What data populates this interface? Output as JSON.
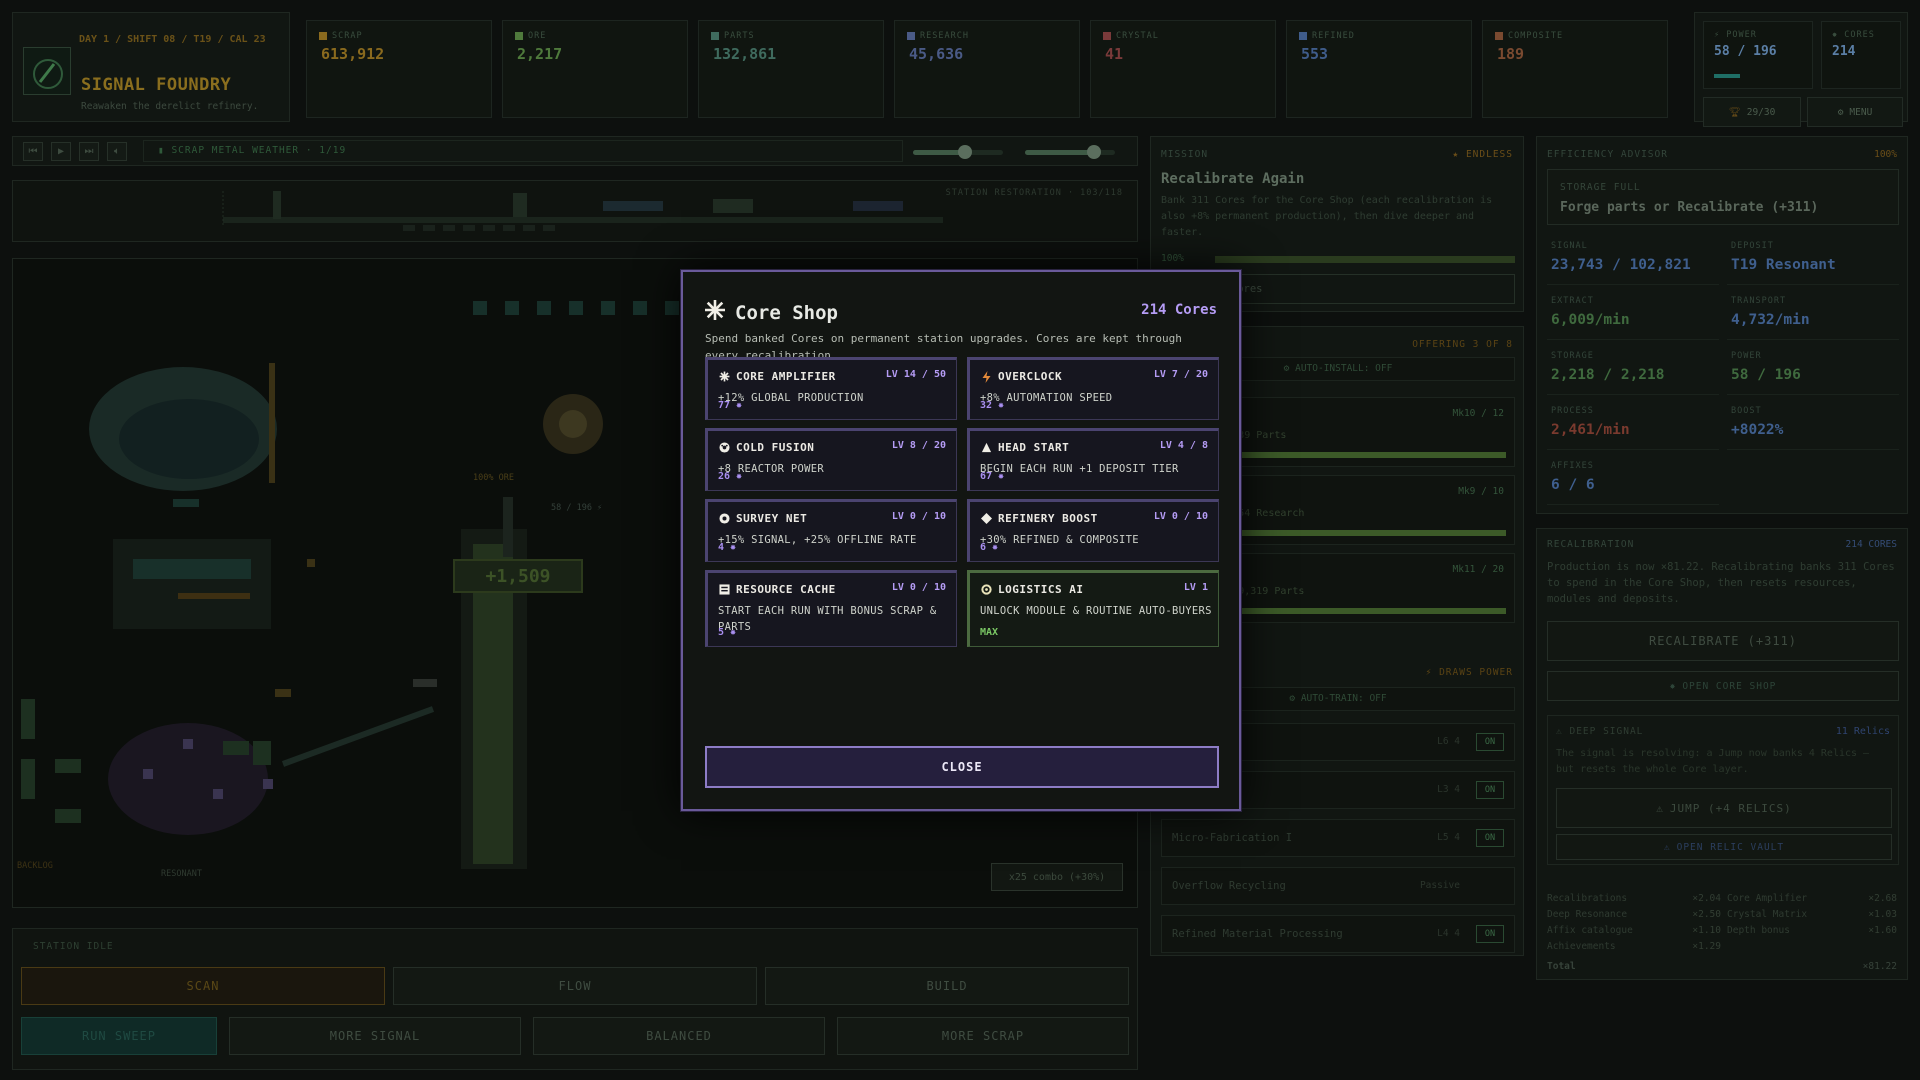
{
  "brand": {
    "meta": "DAY 1 / SHIFT 08 / T19 / CAL 23",
    "title": "SIGNAL FOUNDRY",
    "subtitle": "Reawaken the derelict refinery."
  },
  "resources": [
    {
      "label": "SCRAP",
      "value": "613,912",
      "color": "#8a6a1e"
    },
    {
      "label": "ORE",
      "value": "2,217",
      "color": "#4f7a3c"
    },
    {
      "label": "PARTS",
      "value": "132,861",
      "color": "#3f6b5e"
    },
    {
      "label": "RESEARCH",
      "value": "45,636",
      "color": "#4a5a86"
    },
    {
      "label": "CRYSTAL",
      "value": "41",
      "color": "#7a3a3a"
    },
    {
      "label": "REFINED",
      "value": "553",
      "color": "#3f5c8a"
    },
    {
      "label": "COMPOSITE",
      "value": "189",
      "color": "#7a4a30"
    }
  ],
  "power": {
    "power_label": "POWER",
    "power_value": "58 / 196",
    "cores_label": "CORES",
    "cores_value": "214",
    "slots_label": "29/30",
    "menu_label": "MENU"
  },
  "transport": {
    "weather": "SCRAP METAL WEATHER · 1/19"
  },
  "restoration": {
    "label": "STATION RESTORATION · 103/118"
  },
  "scene": {
    "ore_label": "100% ORE",
    "power_label": "58 / 196 ⚡",
    "popup": "+1,509",
    "backlog": "BACKLOG",
    "resonant": "RESONANT",
    "combo": "x25 combo (+30%)"
  },
  "controls": {
    "status": "STATION IDLE",
    "tabs": [
      "SCAN",
      "FLOW",
      "BUILD"
    ],
    "actions": [
      "RUN SWEEP",
      "MORE SIGNAL",
      "BALANCED",
      "MORE SCRAP"
    ]
  },
  "mission": {
    "header": "MISSION",
    "endless": "ENDLESS",
    "title": "Recalibrate Again",
    "desc": "Bank 311 Cores for the Core Shop (each recalibration is also +8% permanent production), then dive deeper and faster.",
    "pct": "100%",
    "prestige": "Prestige Cores"
  },
  "automation": {
    "offering": "OFFERING 3 OF 8",
    "auto_install": "AUTO-INSTALL: OFF",
    "rows": [
      {
        "name": "d",
        "mk": "Mk10 / 12",
        "cost": "63 Scrap, 639 Parts"
      },
      {
        "name": "Routine",
        "mk": "Mk9 / 10",
        "cost": "23 Parts, 854 Research"
      },
      {
        "name": "ore",
        "mk": "Mk11 / 20",
        "cost": "894 Scrap, 9,319 Parts"
      }
    ],
    "draws_power": "DRAWS POWER",
    "auto_train": "AUTO-TRAIN: OFF",
    "toggles": [
      {
        "name": "r Routine",
        "lv": "L6 4",
        "state": "ON"
      },
      {
        "name": "ng I",
        "lv": "L3 4",
        "state": "ON"
      },
      {
        "name": "Micro-Fabrication I",
        "lv": "L5 4",
        "state": "ON"
      },
      {
        "name": "Overflow Recycling",
        "lv": "Passive",
        "state": ""
      },
      {
        "name": "Refined Material Processing",
        "lv": "L4 4",
        "state": "ON"
      }
    ]
  },
  "advisor": {
    "header": "EFFICIENCY ADVISOR",
    "pct": "100%",
    "banner_title": "STORAGE FULL",
    "banner_text": "Forge parts or Recalibrate (+311)",
    "stats": [
      {
        "label": "SIGNAL",
        "value": "23,743 / 102,821",
        "color": "#3f5f8e"
      },
      {
        "label": "DEPOSIT",
        "value": "T19 Resonant",
        "color": "#3f5f8e"
      },
      {
        "label": "EXTRACT",
        "value": "6,009/min",
        "color": "#3f6a3e"
      },
      {
        "label": "TRANSPORT",
        "value": "4,732/min",
        "color": "#3f5f8e"
      },
      {
        "label": "STORAGE",
        "value": "2,218 / 2,218",
        "color": "#3f6a3e"
      },
      {
        "label": "POWER",
        "value": "58 / 196",
        "color": "#3f6a3e"
      },
      {
        "label": "PROCESS",
        "value": "2,461/min",
        "color": "#7a3a2e"
      },
      {
        "label": "BOOST",
        "value": "+8022%",
        "color": "#3f5f8e"
      },
      {
        "label": "AFFIXES",
        "value": "6 / 6",
        "color": "#3f5f8e"
      }
    ]
  },
  "recalibration": {
    "header": "RECALIBRATION",
    "cores": "214 CORES",
    "desc": "Production is now ×81.22. Recalibrating banks 311 Cores to spend in the Core Shop, then resets resources, modules and deposits.",
    "recal_button": "RECALIBRATE (+311)",
    "open_shop": "OPEN CORE SHOP",
    "deep_title": "DEEP SIGNAL",
    "deep_relics": "11 Relics",
    "deep_desc": "The signal is resolving: a Jump now banks 4 Relics — but resets the whole Core layer.",
    "jump_button": "JUMP (+4 RELICS)",
    "vault_button": "OPEN RELIC VAULT",
    "multipliers": [
      {
        "k": "Recalibrations",
        "v": "×2.04",
        "k2": "Core Amplifier",
        "v2": "×2.68"
      },
      {
        "k": "Deep Resonance",
        "v": "×2.50",
        "k2": "Crystal Matrix",
        "v2": "×1.03"
      },
      {
        "k": "Affix catalogue",
        "v": "×1.10",
        "k2": "Depth bonus",
        "v2": "×1.60"
      },
      {
        "k": "Achievements",
        "v": "×1.29",
        "k2": "",
        "v2": ""
      }
    ],
    "total_label": "Total",
    "total_value": "×81.22"
  },
  "modal": {
    "title": "Core Shop",
    "cores": "214 Cores",
    "desc": "Spend banked Cores on permanent station upgrades. Cores are kept through every recalibration.",
    "upgrades": [
      {
        "icon": "sparkle",
        "name": "CORE AMPLIFIER",
        "level": "LV 14 / 50",
        "desc": "+12% GLOBAL PRODUCTION",
        "cost": "77 ✸"
      },
      {
        "icon": "bolt",
        "name": "OVERCLOCK",
        "level": "LV 7 / 20",
        "desc": "+8% AUTOMATION SPEED",
        "cost": "32 ✸"
      },
      {
        "icon": "reactor",
        "name": "COLD FUSION",
        "level": "LV 8 / 20",
        "desc": "+8 REACTOR POWER",
        "cost": "26 ✸"
      },
      {
        "icon": "triangle",
        "name": "HEAD START",
        "level": "LV 4 / 8",
        "desc": "BEGIN EACH RUN +1 DEPOSIT TIER",
        "cost": "67 ✸"
      },
      {
        "icon": "target",
        "name": "SURVEY NET",
        "level": "LV 0 / 10",
        "desc": "+15% SIGNAL, +25% OFFLINE RATE",
        "cost": "4 ✸"
      },
      {
        "icon": "diamond",
        "name": "REFINERY BOOST",
        "level": "LV 0 / 10",
        "desc": "+30% REFINED & COMPOSITE",
        "cost": "6 ✸"
      },
      {
        "icon": "box",
        "name": "RESOURCE CACHE",
        "level": "LV 0 / 10",
        "desc": "START EACH RUN WITH BONUS SCRAP & PARTS",
        "cost": "5 ✸"
      },
      {
        "icon": "gear",
        "name": "LOGISTICS AI",
        "level": "LV 1",
        "desc": "UNLOCK MODULE & ROUTINE AUTO-BUYERS",
        "cost": "MAX"
      }
    ],
    "close_label": "CLOSE"
  }
}
